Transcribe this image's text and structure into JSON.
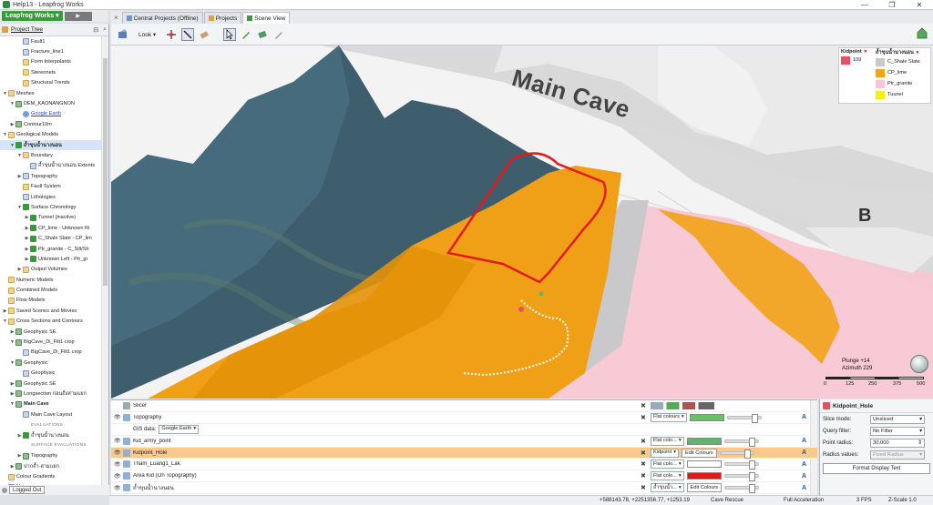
{
  "window": {
    "title": "Help13 - Leapfrog Works",
    "min": "—",
    "max": "❐",
    "close": "✕"
  },
  "brand": {
    "label": "Leapfrog Works ▾",
    "play": "▶"
  },
  "tabs": [
    {
      "label": "Central Projects (Offline)"
    },
    {
      "label": "Projects"
    },
    {
      "label": "Scene View"
    }
  ],
  "project_tree": {
    "title": "Project Tree",
    "rows": [
      {
        "text": "Fault1",
        "icon": "doc",
        "indent": 2
      },
      {
        "text": "Fracture_line1",
        "icon": "doc",
        "indent": 2
      },
      {
        "text": "Form Interpolants",
        "icon": "folder",
        "indent": 2
      },
      {
        "text": "Stereonets",
        "icon": "folder",
        "indent": 2
      },
      {
        "text": "Structural Trends",
        "icon": "folder",
        "indent": 2
      },
      {
        "text": "Meshes",
        "icon": "folder",
        "indent": 0,
        "tw": "▼"
      },
      {
        "text": "DEM_KAONANGNON",
        "icon": "mesh",
        "indent": 1,
        "tw": "▼"
      },
      {
        "text": "Google Earth",
        "icon": "globe",
        "indent": 2,
        "link": true
      },
      {
        "text": "Contour10m",
        "icon": "mesh",
        "indent": 1,
        "tw": "▶"
      },
      {
        "text": "Geological Models",
        "icon": "folder",
        "indent": 0,
        "tw": "▼"
      },
      {
        "text": "ถ้ำขุนน้ำนางนอน",
        "icon": "green",
        "indent": 1,
        "tw": "▼",
        "bold": true,
        "sel": true
      },
      {
        "text": "Boundary",
        "icon": "folder",
        "indent": 2,
        "tw": "▼"
      },
      {
        "text": "ถ้ำขุนน้ำนางนอน Extents",
        "icon": "doc",
        "indent": 3
      },
      {
        "text": "Topography",
        "icon": "doc",
        "indent": 2,
        "tw": "▶"
      },
      {
        "text": "Fault System",
        "icon": "folder",
        "indent": 2
      },
      {
        "text": "Lithologies",
        "icon": "doc",
        "indent": 2
      },
      {
        "text": "Surface Chronology",
        "icon": "green",
        "indent": 2,
        "tw": "▼"
      },
      {
        "text": "Tunnel (inactive)",
        "icon": "green",
        "indent": 3,
        "tw": "▶"
      },
      {
        "text": "CP_lime - Unknown Ri",
        "icon": "green",
        "indent": 3,
        "tw": "▶"
      },
      {
        "text": "C_Shale Slate - CP_lim",
        "icon": "green",
        "indent": 3,
        "tw": "▶"
      },
      {
        "text": "Ptr_granite - C_Silt/Sh",
        "icon": "green",
        "indent": 3,
        "tw": "▶"
      },
      {
        "text": "Unknown Left - Ptr_gr",
        "icon": "green",
        "indent": 3,
        "tw": "▶"
      },
      {
        "text": "Output Volumes",
        "icon": "folder",
        "indent": 2,
        "tw": "▶"
      },
      {
        "text": "Numeric Models",
        "icon": "folder",
        "indent": 0
      },
      {
        "text": "Combined Models",
        "icon": "folder",
        "indent": 0
      },
      {
        "text": "Flow Models",
        "icon": "folder",
        "indent": 0
      },
      {
        "text": "Saved Scenes and Movies",
        "icon": "folder",
        "indent": 0,
        "tw": "▶"
      },
      {
        "text": "Cross Sections and Contours",
        "icon": "folder",
        "indent": 0,
        "tw": "▼"
      },
      {
        "text": "Geophysic SE",
        "icon": "mesh",
        "indent": 1,
        "tw": "▶"
      },
      {
        "text": "BigCave_Di_Filt1 crop",
        "icon": "mesh",
        "indent": 1,
        "tw": "▼"
      },
      {
        "text": "BigCave_Di_Filt1 crop",
        "icon": "doc",
        "indent": 2
      },
      {
        "text": "Geophysic",
        "icon": "mesh",
        "indent": 1,
        "tw": "▼"
      },
      {
        "text": "Geophysic",
        "icon": "doc",
        "indent": 2
      },
      {
        "text": "Geophysic SE",
        "icon": "mesh",
        "indent": 1,
        "tw": "▶"
      },
      {
        "text": "Longsection ก่อนถึงสามแยก",
        "icon": "mesh",
        "indent": 1,
        "tw": "▶"
      },
      {
        "text": "Main Cave",
        "icon": "mesh",
        "indent": 1,
        "tw": "▼",
        "bold": true
      },
      {
        "text": "Main Cave Layout",
        "icon": "doc",
        "indent": 2
      },
      {
        "text": "EVALUATIONS",
        "icon": "none",
        "indent": 2,
        "sub": true
      },
      {
        "text": "ถ้ำขุนน้ำนางนอน",
        "icon": "green",
        "indent": 2,
        "tw": "▶"
      },
      {
        "text": "SURFACE EVALUATIONS",
        "icon": "none",
        "indent": 2,
        "sub": true
      },
      {
        "text": "Topography",
        "icon": "mesh",
        "indent": 2,
        "tw": "▶"
      },
      {
        "text": "ปากถ้ำ-สามแยก",
        "icon": "mesh",
        "indent": 1,
        "tw": "▶"
      },
      {
        "text": "Colour Gradients",
        "icon": "folder",
        "indent": 0
      },
      {
        "text": "Notes",
        "icon": "doc",
        "indent": 0
      }
    ]
  },
  "logged_out": "Logged Out",
  "toolbar": {
    "look": "Look ▾"
  },
  "scene": {
    "main_cave": "Main Cave",
    "b_label": "B"
  },
  "legend": {
    "kidpoint": {
      "title": "Kidpoint",
      "items": [
        {
          "label": "109",
          "color": "#e8505b"
        }
      ]
    },
    "lith": {
      "title": "ถ้ำขุนน้ำนางนอน",
      "items": [
        {
          "label": "C_Shale Slate",
          "color": "#c9c9cb"
        },
        {
          "label": "CP_lime",
          "color": "#f2a317"
        },
        {
          "label": "Ptr_granite",
          "color": "#f7c7d4"
        },
        {
          "label": "Tuunel",
          "color": "#f7ee14"
        }
      ]
    }
  },
  "compass": {
    "plunge": "Plunge +14",
    "azimuth": "Azimuth 229",
    "ticks": [
      "0",
      "125",
      "250",
      "375",
      "500"
    ]
  },
  "layers": [
    {
      "name": "Slicer",
      "type": "slicer"
    },
    {
      "name": "Topography",
      "type": "flat",
      "mode": "Flat colours",
      "color": "#6bbf6b"
    },
    {
      "name": "GIS data:",
      "type": "gis",
      "value": "Google Earth"
    },
    {
      "name": "Kid_army_point",
      "type": "flat",
      "mode": "Flat colo...",
      "color": "#5fb56a"
    },
    {
      "name": "Kidpoint_Hole",
      "type": "kid",
      "mode": "Kidpoint",
      "edit": "Edit Colours",
      "sel": true
    },
    {
      "name": "Tham_Luang1_Lak",
      "type": "flat",
      "mode": "Flat colo...",
      "color": "#ffffff"
    },
    {
      "name": "Area Kid (On Topography)",
      "type": "flat",
      "mode": "Flat colo...",
      "color": "#e01b1b"
    },
    {
      "name": "ถ้ำขุนน้ำนางนอน",
      "type": "flat2",
      "mode": "ถ้ำขุนน้ำ...",
      "edit": "Edit Colours"
    }
  ],
  "props": {
    "title": "Kidpoint_Hole",
    "slice_mode_label": "Slice mode:",
    "slice_mode": "Unsliced",
    "query_label": "Query filter:",
    "query": "No Filter",
    "radius_label": "Point radius:",
    "radius": "30.000",
    "radius_values_label": "Radius values:",
    "radius_values": "Fixed Radius",
    "format_btn": "Format Display Text"
  },
  "status": {
    "coords": "+588143.78, +2251356.77, +1253.19",
    "mode": "Cave Rescue",
    "accel": "Full Acceleration",
    "fps": "3 FPS",
    "zscale": "Z-Scale 1.0"
  }
}
